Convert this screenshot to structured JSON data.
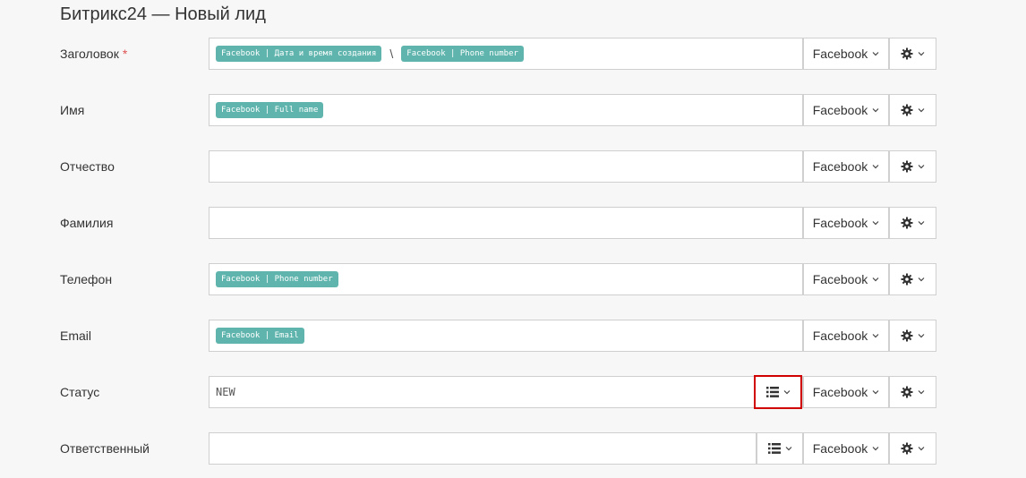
{
  "page": {
    "title": "Битрикс24 — Новый лид"
  },
  "icons": {
    "settings": "gear-icon",
    "dropdown": "chevron-down-icon",
    "list": "list-icon"
  },
  "colors": {
    "tag_bg": "#5fb5ad",
    "required": "#e05353",
    "highlight": "#d00000"
  },
  "rows": [
    {
      "label": "Заголовок",
      "required": "*",
      "tags": [
        "Facebook | Дата и время создания",
        "Facebook | Phone number"
      ],
      "separator": "\\",
      "source": "Facebook"
    },
    {
      "label": "Имя",
      "tags": [
        "Facebook | Full name"
      ],
      "source": "Facebook"
    },
    {
      "label": "Отчество",
      "source": "Facebook"
    },
    {
      "label": "Фамилия",
      "source": "Facebook"
    },
    {
      "label": "Телефон",
      "tags": [
        "Facebook | Phone number"
      ],
      "source": "Facebook"
    },
    {
      "label": "Email",
      "tags": [
        "Facebook | Email"
      ],
      "source": "Facebook"
    },
    {
      "label": "Статус",
      "value": "NEW",
      "source": "Facebook"
    },
    {
      "label": "Ответственный",
      "value": "",
      "source": "Facebook"
    }
  ]
}
